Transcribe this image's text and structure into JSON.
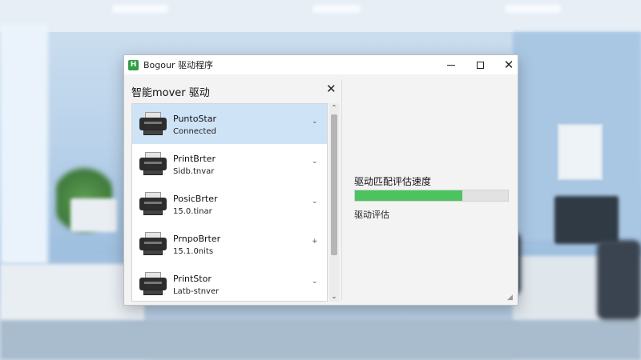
{
  "window": {
    "title": "Bogour 驱动程序",
    "icon": "app-icon",
    "icon_glyph": "H",
    "minimize_glyph": "",
    "maximize_glyph": "",
    "close_glyph": "✕"
  },
  "panel": {
    "title": "智能mover 驱动",
    "close_glyph": "✕"
  },
  "printers": [
    {
      "name": "PuntoStar",
      "status": "Connected",
      "selected": true,
      "chevron": "⌄"
    },
    {
      "name": "PrintBrter",
      "status": "Sidb.tnvar",
      "selected": false,
      "chevron": "⌄"
    },
    {
      "name": "PosicBrter",
      "status": "15.0.tinar",
      "selected": false,
      "chevron": "⌄"
    },
    {
      "name": "PrnpoBrter",
      "status": "15.1.0nits",
      "selected": false,
      "chevron": "+"
    },
    {
      "name": "PrintStor",
      "status": "Latb-stnver",
      "selected": false,
      "chevron": "⌄"
    }
  ],
  "scrollbar": {
    "up_glyph": "⌃",
    "down_glyph": "⌄"
  },
  "progress": {
    "label": "驱动匹配评估速度",
    "value_percent": 70,
    "sub_label": "驱动评估",
    "color": "#4cc35e"
  },
  "colors": {
    "selected_row": "#cfe3f7",
    "accent": "#2f9e44"
  }
}
